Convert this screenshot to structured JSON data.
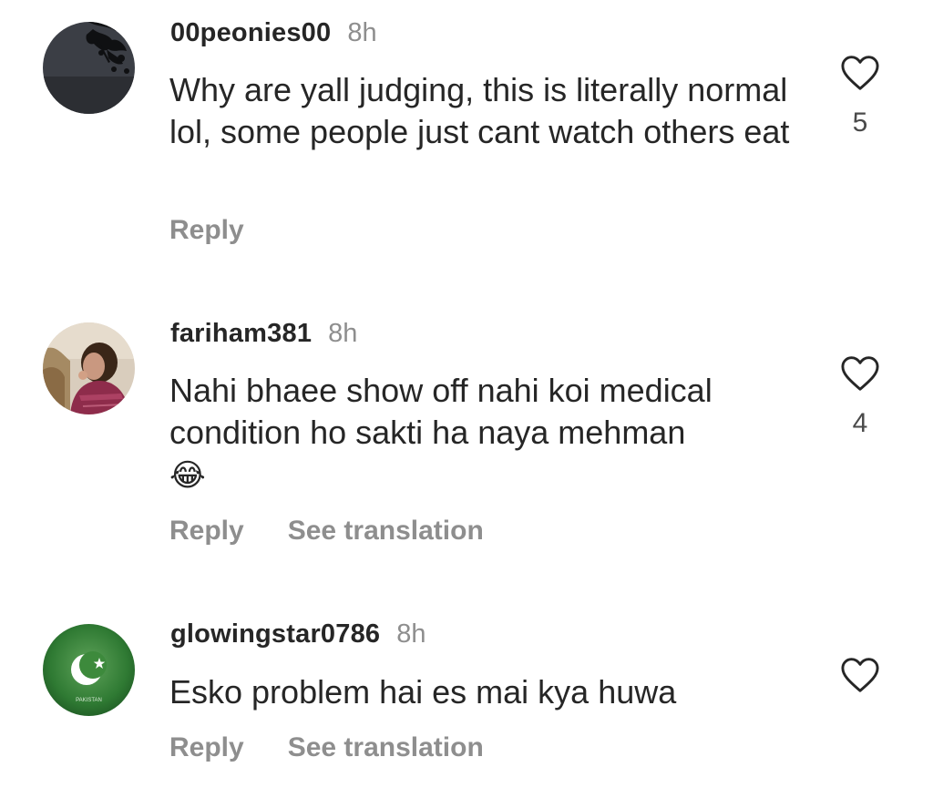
{
  "comments": [
    {
      "username": "00peonies00",
      "time": "8h",
      "text": "Why are yall judging, this is literally normal lol, some people just cant watch others eat",
      "emoji": "",
      "actions": [
        "Reply"
      ],
      "likes": "5",
      "avatar_icon": "tree-silhouette-avatar"
    },
    {
      "username": "fariham381",
      "time": "8h",
      "text": "Nahi bhaee show off nahi koi medical condition ho sakti ha naya mehman",
      "emoji": "😂",
      "actions": [
        "Reply",
        "See translation"
      ],
      "likes": "4",
      "avatar_icon": "portrait-photo-avatar"
    },
    {
      "username": "glowingstar0786",
      "time": "8h",
      "text": "Esko problem hai es mai kya huwa",
      "emoji": "",
      "actions": [
        "Reply",
        "See translation"
      ],
      "likes": "",
      "avatar_icon": "pakistan-flag-avatar",
      "avatar_caption": "PAKISTAN"
    }
  ],
  "colors": {
    "text": "#262626",
    "muted": "#8e8e8e",
    "heart_outline": "#262626"
  }
}
